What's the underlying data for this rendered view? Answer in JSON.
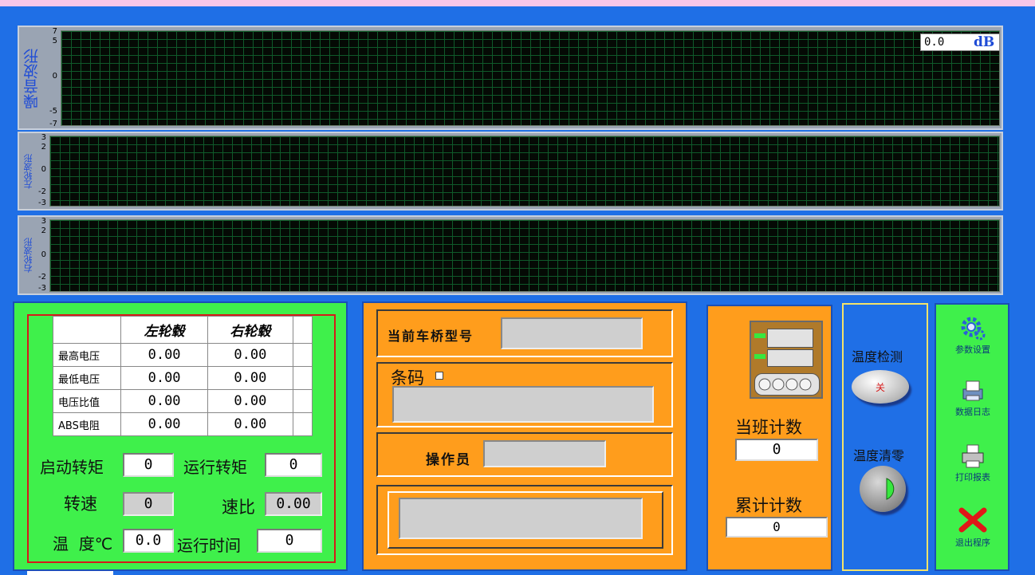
{
  "charts": {
    "noise": {
      "label": "噪音波形",
      "ticks": [
        "7",
        "5",
        "0",
        "-5",
        "-7"
      ],
      "readout_value": "0.0",
      "readout_unit": "dB"
    },
    "left": {
      "label": "左轮波形",
      "ticks": [
        "3",
        "2",
        "0",
        "-2",
        "-3"
      ]
    },
    "right": {
      "label": "右轮波形",
      "ticks": [
        "3",
        "2",
        "0",
        "-2",
        "-3"
      ]
    }
  },
  "voltage_table": {
    "headers": [
      "",
      "左轮毂",
      "右轮毂"
    ],
    "rows": [
      {
        "label": "最高电压",
        "left": "0.00",
        "right": "0.00"
      },
      {
        "label": "最低电压",
        "left": "0.00",
        "right": "0.00"
      },
      {
        "label": "电压比值",
        "left": "0.00",
        "right": "0.00"
      },
      {
        "label": "ABS电阻",
        "left": "0.00",
        "right": "0.00"
      }
    ]
  },
  "measurements": {
    "start_torque_label": "启动转矩",
    "start_torque": "0",
    "run_torque_label": "运行转矩",
    "run_torque": "0",
    "speed_label": "转速",
    "speed": "0",
    "ratio_label": "速比",
    "ratio": "0.00",
    "temp_label": "温  度℃",
    "temp": "0.0",
    "runtime_label": "运行时间",
    "runtime": "0"
  },
  "product": {
    "model_label": "当前车桥型号",
    "model_value": "",
    "barcode_label": "条码",
    "barcode_value": "",
    "operator_label": "操作员",
    "operator_value": "",
    "message_value": ""
  },
  "counters": {
    "shift_label": "当班计数",
    "shift_value": "0",
    "total_label": "累计计数",
    "total_value": "0"
  },
  "temperature": {
    "detect_label": "温度检测",
    "switch_text": "关",
    "reset_label": "温度清零"
  },
  "sidebar": {
    "settings": "参数设置",
    "log": "数据日志",
    "print": "打印报表",
    "exit": "退出程序"
  },
  "colors": {
    "app_bg": "#1f6fe6",
    "green_panel": "#3ff04b",
    "orange_panel": "#ff9d1c",
    "table_border": "#d61a1a"
  }
}
